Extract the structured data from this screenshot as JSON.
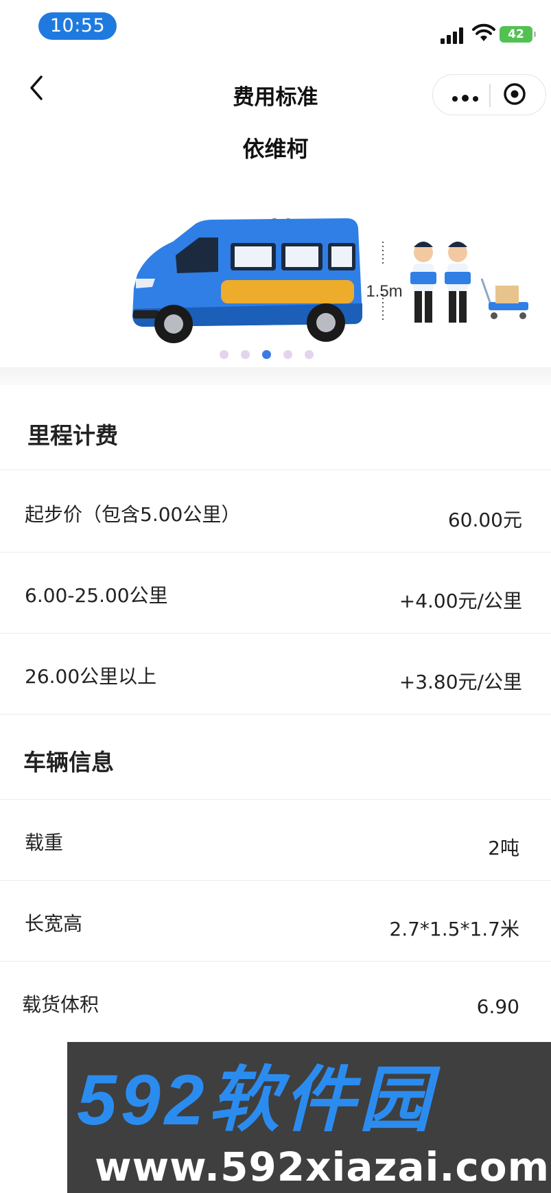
{
  "status_bar": {
    "time": "10:55",
    "battery": "42"
  },
  "nav": {
    "title": "费用标准"
  },
  "vehicle": {
    "name": "依维柯",
    "dim_length": "3.0m",
    "dim_height": "1.5m"
  },
  "carousel": {
    "count": 5,
    "active_index": 2
  },
  "mileage": {
    "title": "里程计费",
    "rows": [
      {
        "label": "起步价（包含5.00公里）",
        "value": "60.00元"
      },
      {
        "label": "6.00-25.00公里",
        "value": "+4.00元/公里"
      },
      {
        "label": "26.00公里以上",
        "value": "+3.80元/公里"
      }
    ]
  },
  "vehicle_info": {
    "title": "车辆信息",
    "rows": [
      {
        "label": "载重",
        "value": "2吨"
      },
      {
        "label": "长宽高",
        "value": "2.7*1.5*1.7米"
      },
      {
        "label": "载货体积",
        "value": "6.90"
      }
    ]
  },
  "watermark": {
    "title": "592软件园",
    "url": "www.592xiazai.com"
  },
  "colors": {
    "accent": "#1f7ae0",
    "van": "#2f7fe6",
    "battery": "#52c152",
    "watermark_bg": "#3f3f3f"
  }
}
